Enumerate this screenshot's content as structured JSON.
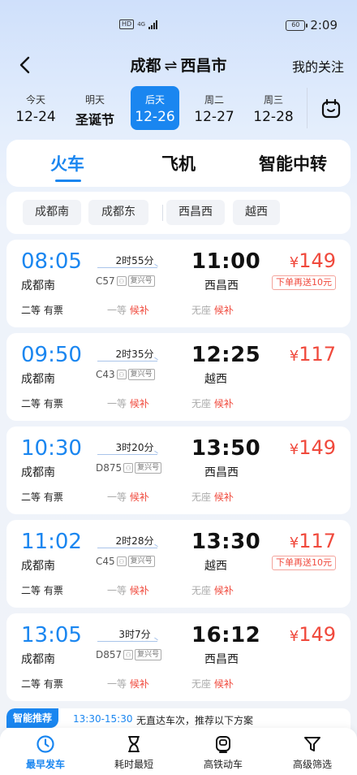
{
  "status_bar": {
    "hd": "HD",
    "network": "4G",
    "battery": "60",
    "time": "2:09"
  },
  "header": {
    "origin": "成都",
    "swap_symbol": "⇌",
    "destination": "西昌市",
    "follow_label": "我的关注"
  },
  "dates": [
    {
      "label": "今天",
      "date": "12-24"
    },
    {
      "label": "明天",
      "date": "圣诞节"
    },
    {
      "label": "后天",
      "date": "12-26"
    },
    {
      "label": "周二",
      "date": "12-27"
    },
    {
      "label": "周三",
      "date": "12-28"
    }
  ],
  "modes": [
    "火车",
    "飞机",
    "智能中转"
  ],
  "filters": [
    "成都南",
    "成都东",
    "西昌西",
    "越西"
  ],
  "trains": [
    {
      "dep_time": "08:05",
      "dep_station": "成都南",
      "duration": "2时55分",
      "train_no": "C57",
      "train_tag": "复兴号",
      "arr_time": "11:00",
      "arr_station": "西昌西",
      "price": "149",
      "promo": "下单再送10元",
      "seat1_name": "二等",
      "seat1_status": "有票",
      "seat2_name": "一等",
      "seat2_status": "候补",
      "seat3_name": "无座",
      "seat3_status": "候补"
    },
    {
      "dep_time": "09:50",
      "dep_station": "成都南",
      "duration": "2时35分",
      "train_no": "C43",
      "train_tag": "复兴号",
      "arr_time": "12:25",
      "arr_station": "越西",
      "price": "117",
      "promo": "",
      "seat1_name": "二等",
      "seat1_status": "有票",
      "seat2_name": "一等",
      "seat2_status": "候补",
      "seat3_name": "无座",
      "seat3_status": "候补"
    },
    {
      "dep_time": "10:30",
      "dep_station": "成都南",
      "duration": "3时20分",
      "train_no": "D875",
      "train_tag": "复兴号",
      "arr_time": "13:50",
      "arr_station": "西昌西",
      "price": "149",
      "promo": "",
      "seat1_name": "二等",
      "seat1_status": "有票",
      "seat2_name": "一等",
      "seat2_status": "候补",
      "seat3_name": "无座",
      "seat3_status": "候补"
    },
    {
      "dep_time": "11:02",
      "dep_station": "成都南",
      "duration": "2时28分",
      "train_no": "C45",
      "train_tag": "复兴号",
      "arr_time": "13:30",
      "arr_station": "越西",
      "price": "117",
      "promo": "下单再送10元",
      "seat1_name": "二等",
      "seat1_status": "有票",
      "seat2_name": "一等",
      "seat2_status": "候补",
      "seat3_name": "无座",
      "seat3_status": "候补"
    },
    {
      "dep_time": "13:05",
      "dep_station": "成都南",
      "duration": "3时7分",
      "train_no": "D857",
      "train_tag": "复兴号",
      "arr_time": "16:12",
      "arr_station": "西昌西",
      "price": "149",
      "promo": "",
      "seat1_name": "二等",
      "seat1_status": "有票",
      "seat2_name": "一等",
      "seat2_status": "候补",
      "seat3_name": "无座",
      "seat3_status": "候补"
    }
  ],
  "currency": "¥",
  "smart": {
    "badge": "智能推荐",
    "time_range": "13:30-15:30",
    "text": "无直达车次，推荐以下方案"
  },
  "nav": [
    {
      "label": "最早发车",
      "icon": "clock-icon"
    },
    {
      "label": "耗时最短",
      "icon": "hourglass-icon"
    },
    {
      "label": "高铁动车",
      "icon": "train-icon"
    },
    {
      "label": "高级筛选",
      "icon": "filter-icon"
    }
  ],
  "colors": {
    "accent": "#1a86f0",
    "price": "#f0493c"
  }
}
